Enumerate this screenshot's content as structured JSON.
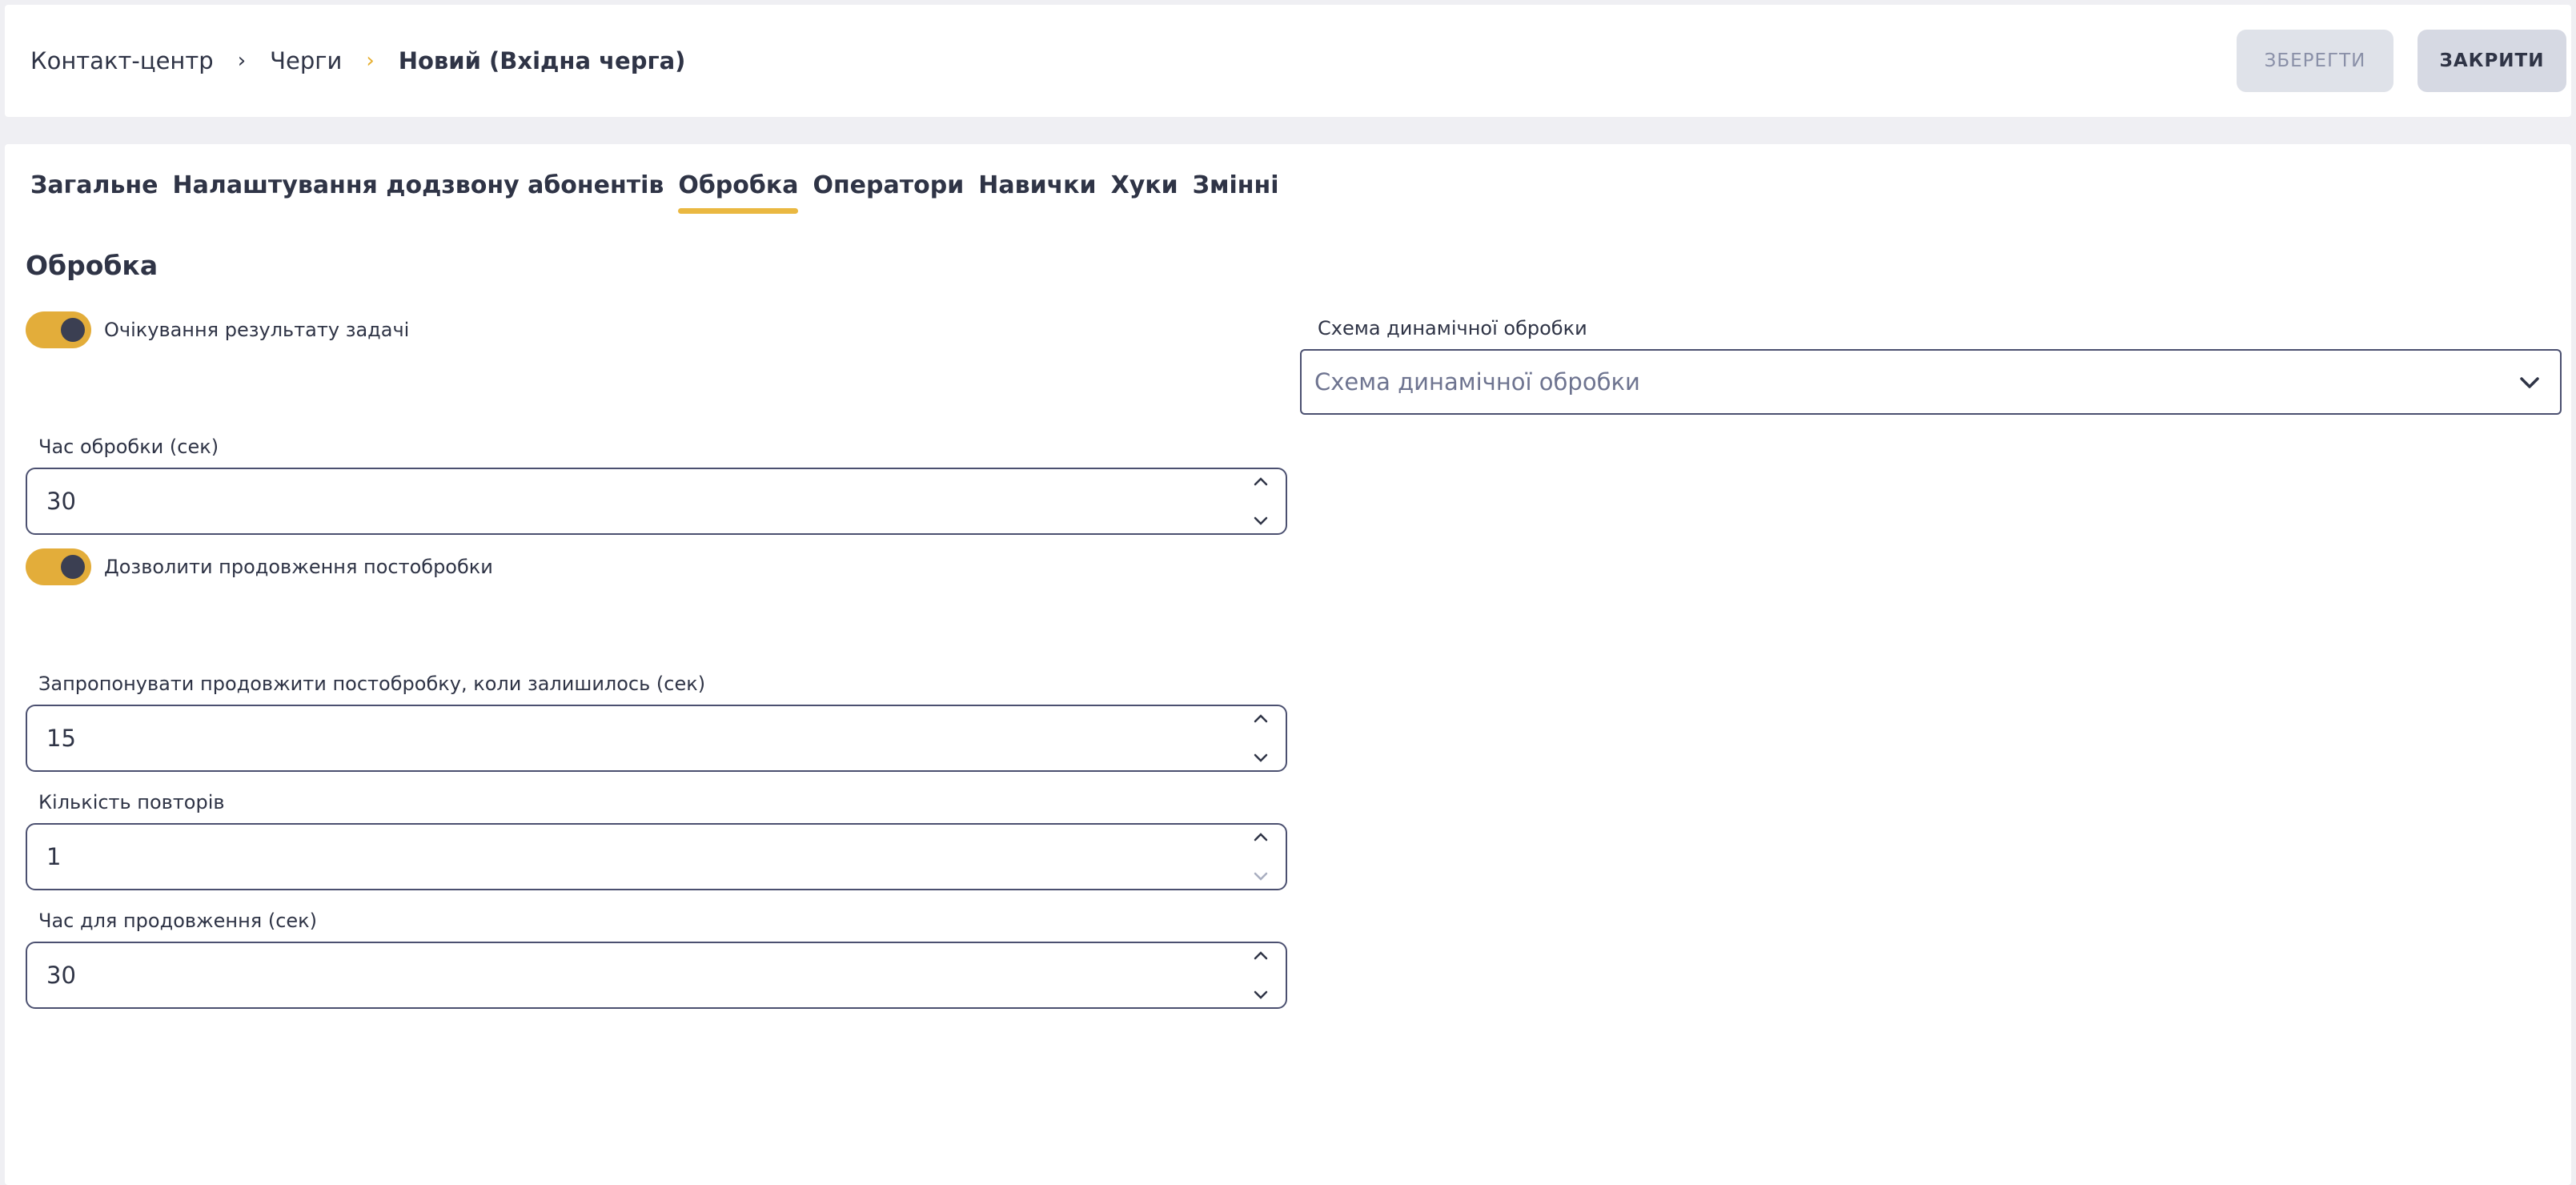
{
  "breadcrumb": {
    "items": [
      "Контакт-центр",
      "Черги"
    ],
    "separator": "›",
    "current": "Новий (Вхідна черга)"
  },
  "toolbar": {
    "save_label": "ЗБЕРЕГТИ",
    "close_label": "ЗАКРИТИ"
  },
  "tabs": [
    {
      "label": "Загальне",
      "active": false
    },
    {
      "label": "Налаштування додзвону абонентів",
      "active": false
    },
    {
      "label": "Обробка",
      "active": true
    },
    {
      "label": "Оператори",
      "active": false
    },
    {
      "label": "Навички",
      "active": false
    },
    {
      "label": "Хуки",
      "active": false
    },
    {
      "label": "Змінні",
      "active": false
    }
  ],
  "section": {
    "title": "Обробка"
  },
  "form": {
    "wait_task_result": {
      "label": "Очікування результату задачі",
      "on": true
    },
    "dynamic_schema": {
      "label": "Схема динамічної обробки",
      "placeholder": "Схема динамічної обробки"
    },
    "processing_time": {
      "label": "Час обробки (сек)",
      "value": "30"
    },
    "allow_extend": {
      "label": "Дозволити продовження постобробки",
      "on": true
    },
    "offer_extend_when_left": {
      "label": "Запропонувати продовжити постобробку, коли залишилось (сек)",
      "value": "15"
    },
    "repeat_count": {
      "label": "Кількість повторів",
      "value": "1"
    },
    "extend_time": {
      "label": "Час для продовження (сек)",
      "value": "30"
    }
  },
  "colors": {
    "accent": "#e3ad3a",
    "text": "#2f3446",
    "border": "#4b5070",
    "background": "#efeff3"
  }
}
